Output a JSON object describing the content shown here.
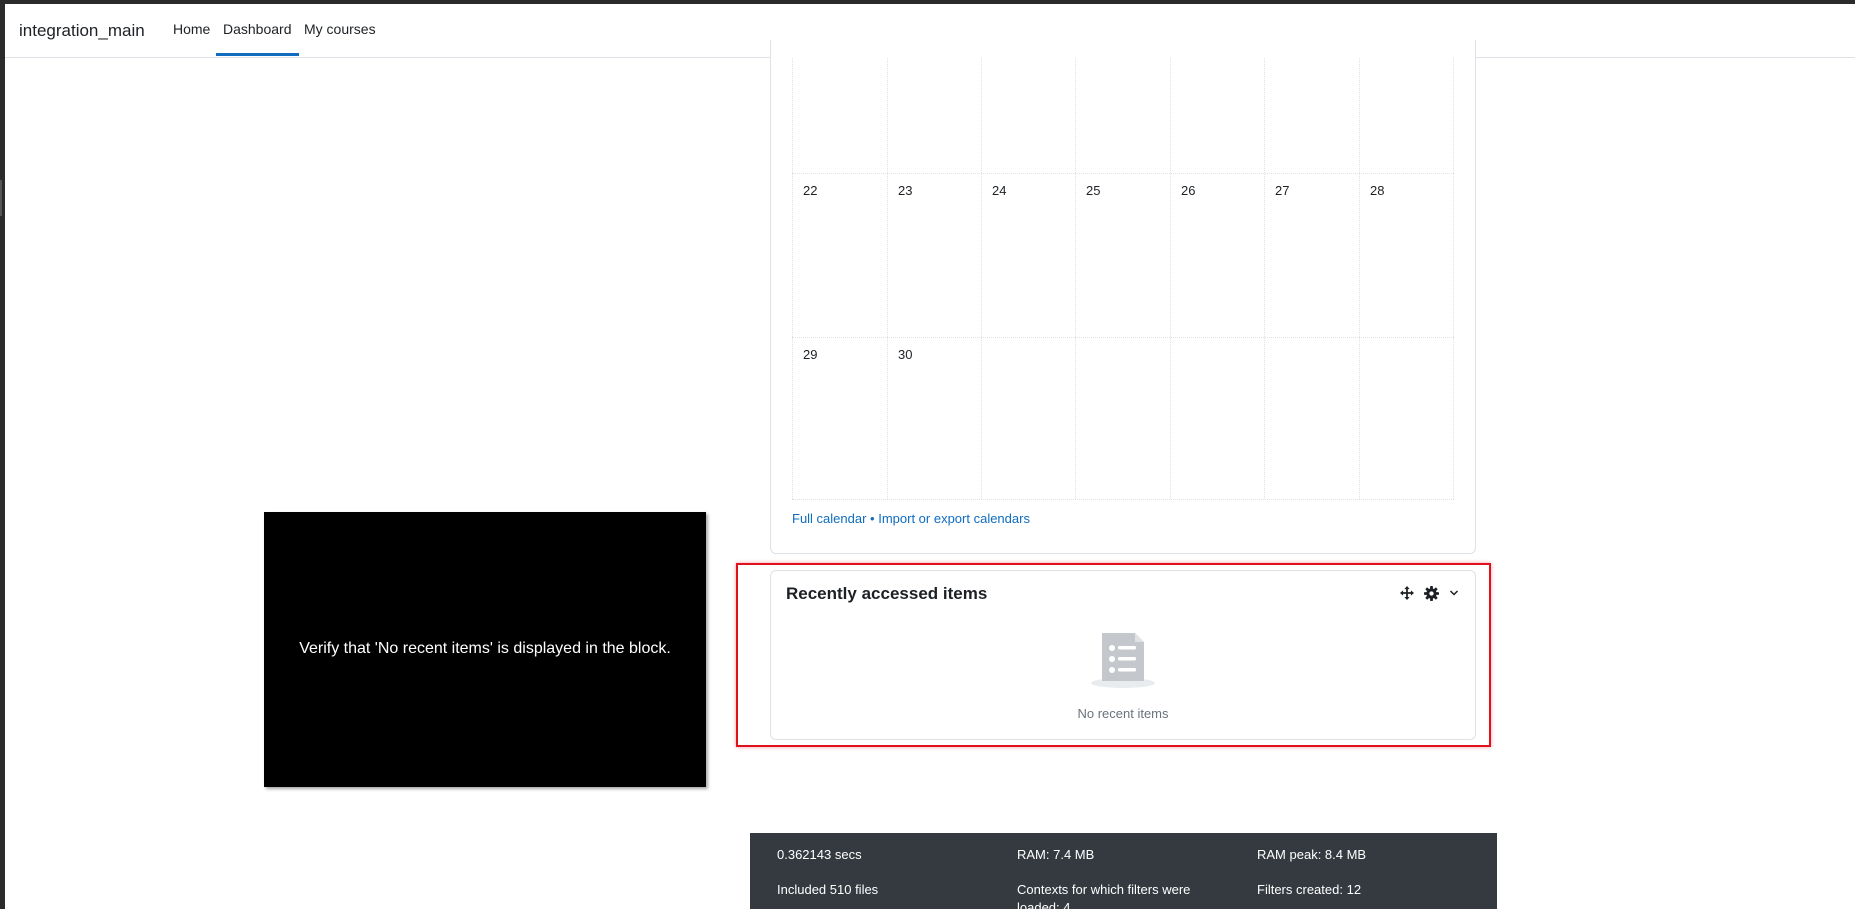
{
  "navbar": {
    "brand": "integration_main",
    "links": [
      {
        "label": "Home"
      },
      {
        "label": "Dashboard",
        "active": true
      },
      {
        "label": "My courses"
      }
    ]
  },
  "calendar": {
    "rows": [
      [
        "",
        "",
        "",
        "",
        "",
        "",
        ""
      ],
      [
        "22",
        "23",
        "24",
        "25",
        "26",
        "27",
        "28"
      ],
      [
        "29",
        "30",
        "",
        "",
        "",
        "",
        ""
      ]
    ],
    "links": {
      "full_calendar": "Full calendar",
      "separator": " • ",
      "import_export": "Import or export calendars"
    }
  },
  "overlay": {
    "text": "Verify that 'No recent items' is displayed in the block."
  },
  "recent_block": {
    "title": "Recently accessed items",
    "empty_text": "No recent items",
    "icons": [
      "move-icon",
      "gear-icon",
      "chevron-down-icon"
    ]
  },
  "performance": {
    "time": "0.362143 secs",
    "ram": "RAM: 7.4 MB",
    "ram_peak": "RAM peak: 8.4 MB",
    "files": "Included 510 files",
    "contexts": "Contexts for which filters were loaded: 4",
    "filters": "Filters created: 12"
  },
  "colors": {
    "accent": "#0f6cbf",
    "highlight": "#e0101d",
    "footer_bg": "#343a40"
  }
}
